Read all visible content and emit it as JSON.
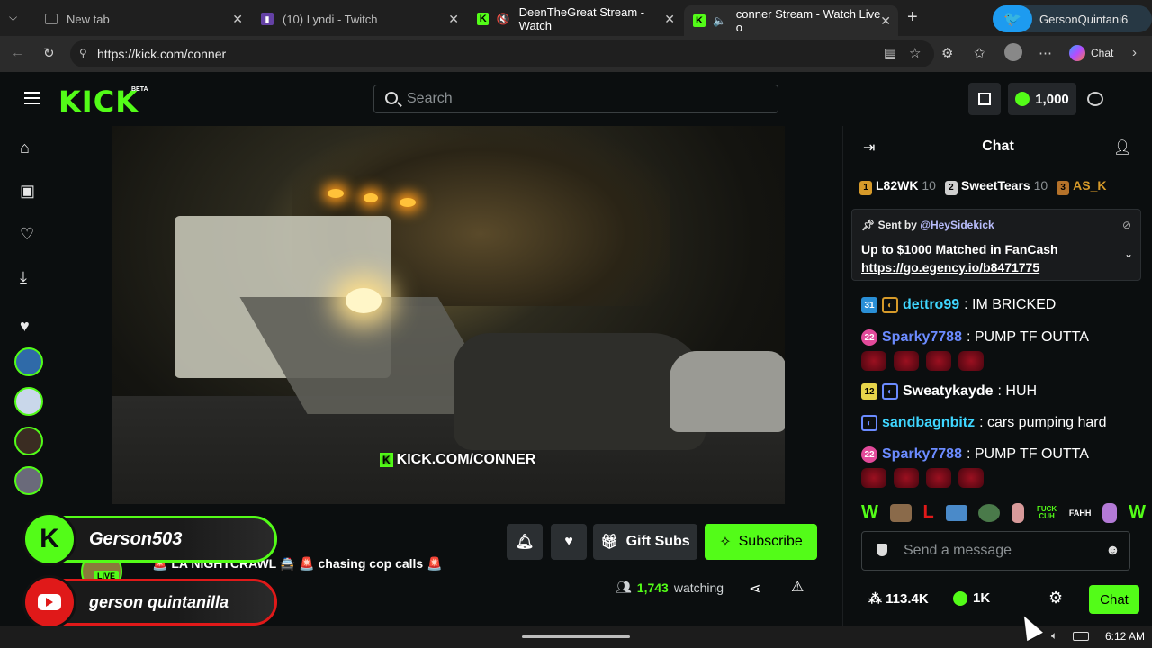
{
  "browser": {
    "tabs": [
      {
        "title": "New tab"
      },
      {
        "title": "(10) Lyndi - Twitch"
      },
      {
        "title": "DeenTheGreat Stream - Watch"
      },
      {
        "title": "conner Stream - Watch Live o"
      }
    ],
    "profile_name": "GersonQuintani6",
    "url": "https://kick.com/conner",
    "copilot_label": "Chat"
  },
  "header": {
    "logo_text": "KICK",
    "logo_badge": "BETA",
    "search_placeholder": "Search",
    "balance": "1,000"
  },
  "video": {
    "watermark": "KICK.COM/CONNER"
  },
  "stream": {
    "title": "🚨 LA NIGHTCRAWL 🚔 🚨 chasing cop calls 🚨",
    "live_badge": "LIVE",
    "gift_label": "Gift Subs",
    "subscribe_label": "Subscribe",
    "viewers": "1,743",
    "viewers_suffix": "watching"
  },
  "overlay": {
    "kick_name": "Gerson503",
    "youtube_name": "gerson quintanilla"
  },
  "chat": {
    "title": "Chat",
    "leaders": [
      {
        "name": "L82WK",
        "count": "10"
      },
      {
        "name": "SweetTears",
        "count": "10"
      },
      {
        "name": "AS_K",
        "count": ""
      }
    ],
    "pinned": {
      "sent_by": "Sent by",
      "sender": "@HeySidekick",
      "message": "Up to $1000 Matched in FanCash",
      "link": "https://go.egency.io/b8471775"
    },
    "messages": [
      {
        "badge": "31",
        "user": "dettro99",
        "text": ": IM BRICKED",
        "color": "#3fd6ff"
      },
      {
        "badge": "22",
        "user": "Sparky7788",
        "text": ": PUMP TF OUTTA",
        "color": "#6b8bff"
      },
      {
        "badge": "12",
        "user": "Sweatykayde",
        "text": ": HUH",
        "color": "#ffffff"
      },
      {
        "badge": "",
        "user": "sandbagnbitz",
        "text": ": cars pumping hard",
        "color": "#3fd6ff"
      },
      {
        "badge": "22",
        "user": "Sparky7788",
        "text": ": PUMP TF OUTTA",
        "color": "#6b8bff"
      }
    ],
    "emotes": [
      "W",
      "L",
      "FUCK CUH",
      "FAHH",
      "W"
    ],
    "input_placeholder": "Send a message",
    "followers": "113.4K",
    "kicks": "1K",
    "send_label": "Chat"
  },
  "taskbar": {
    "time": "6:12 AM"
  },
  "colors": {
    "accent": "#53fc18",
    "background": "#0b0e0f"
  }
}
